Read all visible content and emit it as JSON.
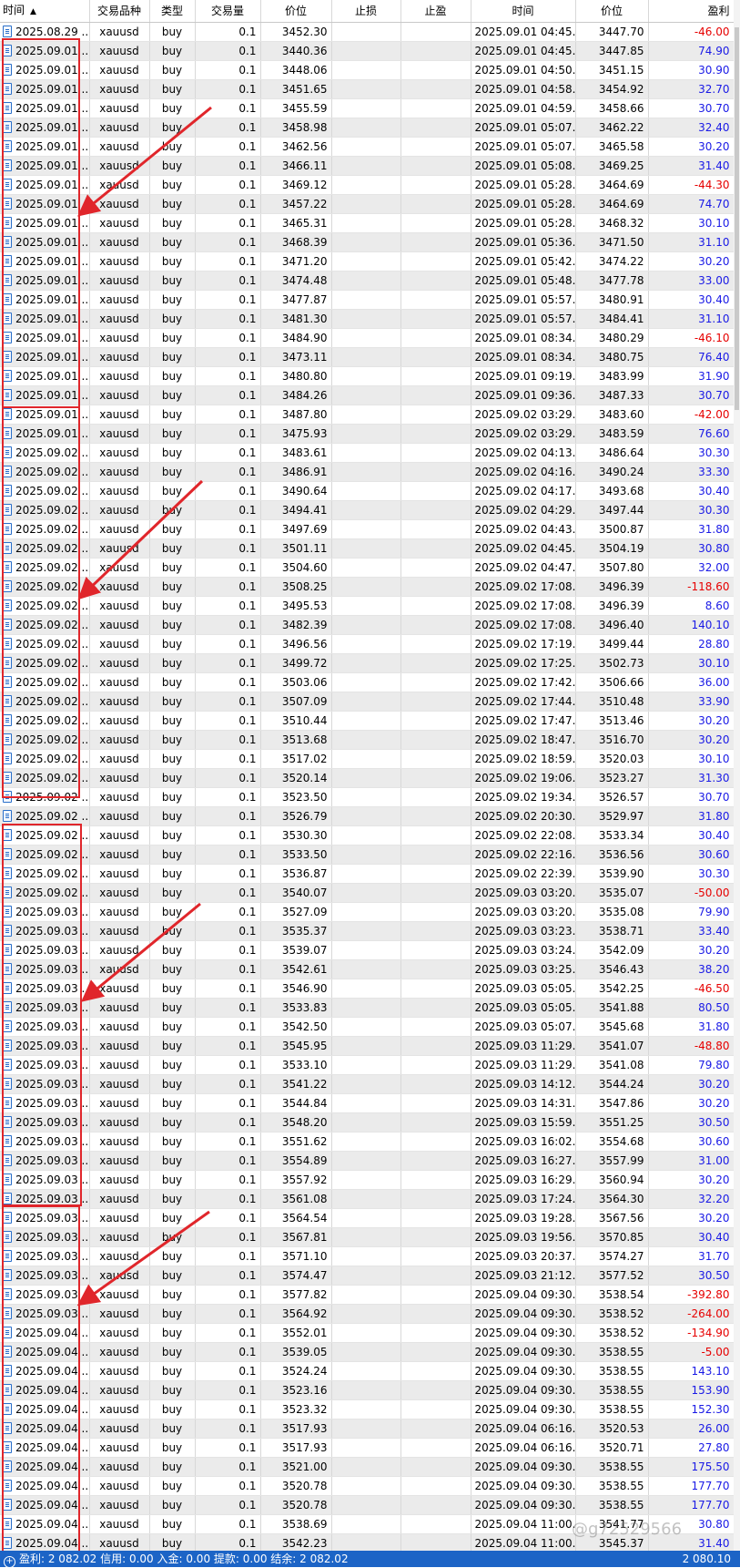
{
  "header": {
    "time": "时间",
    "symbol": "交易品种",
    "type": "类型",
    "volume": "交易量",
    "price": "价位",
    "sl": "止损",
    "tp": "止盈",
    "close_time": "时间",
    "close_price": "价位",
    "profit": "盈利"
  },
  "colors": {
    "status_bar": "#1c64c6",
    "profit_positive": "#1a1ae6",
    "profit_negative": "#e60000",
    "highlight": "#e0262b"
  },
  "rows": [
    {
      "t": "2025.08.29 ...",
      "s": "xauusd",
      "ty": "buy",
      "v": "0.1",
      "p": "3452.30",
      "ct": "2025.09.01 04:45...",
      "cp": "3447.70",
      "pr": "-46.00"
    },
    {
      "t": "2025.09.01 ...",
      "s": "xauusd",
      "ty": "buy",
      "v": "0.1",
      "p": "3440.36",
      "ct": "2025.09.01 04:45...",
      "cp": "3447.85",
      "pr": "74.90"
    },
    {
      "t": "2025.09.01 ...",
      "s": "xauusd",
      "ty": "buy",
      "v": "0.1",
      "p": "3448.06",
      "ct": "2025.09.01 04:50...",
      "cp": "3451.15",
      "pr": "30.90"
    },
    {
      "t": "2025.09.01 ...",
      "s": "xauusd",
      "ty": "buy",
      "v": "0.1",
      "p": "3451.65",
      "ct": "2025.09.01 04:58...",
      "cp": "3454.92",
      "pr": "32.70"
    },
    {
      "t": "2025.09.01 ...",
      "s": "xauusd",
      "ty": "buy",
      "v": "0.1",
      "p": "3455.59",
      "ct": "2025.09.01 04:59...",
      "cp": "3458.66",
      "pr": "30.70"
    },
    {
      "t": "2025.09.01 ...",
      "s": "xauusd",
      "ty": "buy",
      "v": "0.1",
      "p": "3458.98",
      "ct": "2025.09.01 05:07...",
      "cp": "3462.22",
      "pr": "32.40"
    },
    {
      "t": "2025.09.01 ...",
      "s": "xauusd",
      "ty": "buy",
      "v": "0.1",
      "p": "3462.56",
      "ct": "2025.09.01 05:07...",
      "cp": "3465.58",
      "pr": "30.20"
    },
    {
      "t": "2025.09.01 ...",
      "s": "xauusd",
      "ty": "buy",
      "v": "0.1",
      "p": "3466.11",
      "ct": "2025.09.01 05:08...",
      "cp": "3469.25",
      "pr": "31.40"
    },
    {
      "t": "2025.09.01 ...",
      "s": "xauusd",
      "ty": "buy",
      "v": "0.1",
      "p": "3469.12",
      "ct": "2025.09.01 05:28...",
      "cp": "3464.69",
      "pr": "-44.30"
    },
    {
      "t": "2025.09.01 ...",
      "s": "xauusd",
      "ty": "buy",
      "v": "0.1",
      "p": "3457.22",
      "ct": "2025.09.01 05:28...",
      "cp": "3464.69",
      "pr": "74.70"
    },
    {
      "t": "2025.09.01 ...",
      "s": "xauusd",
      "ty": "buy",
      "v": "0.1",
      "p": "3465.31",
      "ct": "2025.09.01 05:28...",
      "cp": "3468.32",
      "pr": "30.10"
    },
    {
      "t": "2025.09.01 ...",
      "s": "xauusd",
      "ty": "buy",
      "v": "0.1",
      "p": "3468.39",
      "ct": "2025.09.01 05:36...",
      "cp": "3471.50",
      "pr": "31.10"
    },
    {
      "t": "2025.09.01 ...",
      "s": "xauusd",
      "ty": "buy",
      "v": "0.1",
      "p": "3471.20",
      "ct": "2025.09.01 05:42...",
      "cp": "3474.22",
      "pr": "30.20"
    },
    {
      "t": "2025.09.01 ...",
      "s": "xauusd",
      "ty": "buy",
      "v": "0.1",
      "p": "3474.48",
      "ct": "2025.09.01 05:48...",
      "cp": "3477.78",
      "pr": "33.00"
    },
    {
      "t": "2025.09.01 ...",
      "s": "xauusd",
      "ty": "buy",
      "v": "0.1",
      "p": "3477.87",
      "ct": "2025.09.01 05:57...",
      "cp": "3480.91",
      "pr": "30.40"
    },
    {
      "t": "2025.09.01 ...",
      "s": "xauusd",
      "ty": "buy",
      "v": "0.1",
      "p": "3481.30",
      "ct": "2025.09.01 05:57...",
      "cp": "3484.41",
      "pr": "31.10"
    },
    {
      "t": "2025.09.01 ...",
      "s": "xauusd",
      "ty": "buy",
      "v": "0.1",
      "p": "3484.90",
      "ct": "2025.09.01 08:34...",
      "cp": "3480.29",
      "pr": "-46.10"
    },
    {
      "t": "2025.09.01 ...",
      "s": "xauusd",
      "ty": "buy",
      "v": "0.1",
      "p": "3473.11",
      "ct": "2025.09.01 08:34...",
      "cp": "3480.75",
      "pr": "76.40"
    },
    {
      "t": "2025.09.01 ...",
      "s": "xauusd",
      "ty": "buy",
      "v": "0.1",
      "p": "3480.80",
      "ct": "2025.09.01 09:19...",
      "cp": "3483.99",
      "pr": "31.90"
    },
    {
      "t": "2025.09.01 ...",
      "s": "xauusd",
      "ty": "buy",
      "v": "0.1",
      "p": "3484.26",
      "ct": "2025.09.01 09:36...",
      "cp": "3487.33",
      "pr": "30.70"
    },
    {
      "t": "2025.09.01 ...",
      "s": "xauusd",
      "ty": "buy",
      "v": "0.1",
      "p": "3487.80",
      "ct": "2025.09.02 03:29...",
      "cp": "3483.60",
      "pr": "-42.00"
    },
    {
      "t": "2025.09.01 ...",
      "s": "xauusd",
      "ty": "buy",
      "v": "0.1",
      "p": "3475.93",
      "ct": "2025.09.02 03:29...",
      "cp": "3483.59",
      "pr": "76.60"
    },
    {
      "t": "2025.09.02 ...",
      "s": "xauusd",
      "ty": "buy",
      "v": "0.1",
      "p": "3483.61",
      "ct": "2025.09.02 04:13...",
      "cp": "3486.64",
      "pr": "30.30"
    },
    {
      "t": "2025.09.02 ...",
      "s": "xauusd",
      "ty": "buy",
      "v": "0.1",
      "p": "3486.91",
      "ct": "2025.09.02 04:16...",
      "cp": "3490.24",
      "pr": "33.30"
    },
    {
      "t": "2025.09.02 ...",
      "s": "xauusd",
      "ty": "buy",
      "v": "0.1",
      "p": "3490.64",
      "ct": "2025.09.02 04:17...",
      "cp": "3493.68",
      "pr": "30.40"
    },
    {
      "t": "2025.09.02 ...",
      "s": "xauusd",
      "ty": "buy",
      "v": "0.1",
      "p": "3494.41",
      "ct": "2025.09.02 04:29...",
      "cp": "3497.44",
      "pr": "30.30"
    },
    {
      "t": "2025.09.02 ...",
      "s": "xauusd",
      "ty": "buy",
      "v": "0.1",
      "p": "3497.69",
      "ct": "2025.09.02 04:43...",
      "cp": "3500.87",
      "pr": "31.80"
    },
    {
      "t": "2025.09.02 ...",
      "s": "xauusd",
      "ty": "buy",
      "v": "0.1",
      "p": "3501.11",
      "ct": "2025.09.02 04:45...",
      "cp": "3504.19",
      "pr": "30.80"
    },
    {
      "t": "2025.09.02 ...",
      "s": "xauusd",
      "ty": "buy",
      "v": "0.1",
      "p": "3504.60",
      "ct": "2025.09.02 04:47...",
      "cp": "3507.80",
      "pr": "32.00"
    },
    {
      "t": "2025.09.02 ...",
      "s": "xauusd",
      "ty": "buy",
      "v": "0.1",
      "p": "3508.25",
      "ct": "2025.09.02 17:08...",
      "cp": "3496.39",
      "pr": "-118.60"
    },
    {
      "t": "2025.09.02 ...",
      "s": "xauusd",
      "ty": "buy",
      "v": "0.1",
      "p": "3495.53",
      "ct": "2025.09.02 17:08...",
      "cp": "3496.39",
      "pr": "8.60"
    },
    {
      "t": "2025.09.02 ...",
      "s": "xauusd",
      "ty": "buy",
      "v": "0.1",
      "p": "3482.39",
      "ct": "2025.09.02 17:08...",
      "cp": "3496.40",
      "pr": "140.10"
    },
    {
      "t": "2025.09.02 ...",
      "s": "xauusd",
      "ty": "buy",
      "v": "0.1",
      "p": "3496.56",
      "ct": "2025.09.02 17:19...",
      "cp": "3499.44",
      "pr": "28.80"
    },
    {
      "t": "2025.09.02 ...",
      "s": "xauusd",
      "ty": "buy",
      "v": "0.1",
      "p": "3499.72",
      "ct": "2025.09.02 17:25...",
      "cp": "3502.73",
      "pr": "30.10"
    },
    {
      "t": "2025.09.02 ...",
      "s": "xauusd",
      "ty": "buy",
      "v": "0.1",
      "p": "3503.06",
      "ct": "2025.09.02 17:42...",
      "cp": "3506.66",
      "pr": "36.00"
    },
    {
      "t": "2025.09.02 ...",
      "s": "xauusd",
      "ty": "buy",
      "v": "0.1",
      "p": "3507.09",
      "ct": "2025.09.02 17:44...",
      "cp": "3510.48",
      "pr": "33.90"
    },
    {
      "t": "2025.09.02 ...",
      "s": "xauusd",
      "ty": "buy",
      "v": "0.1",
      "p": "3510.44",
      "ct": "2025.09.02 17:47...",
      "cp": "3513.46",
      "pr": "30.20"
    },
    {
      "t": "2025.09.02 ...",
      "s": "xauusd",
      "ty": "buy",
      "v": "0.1",
      "p": "3513.68",
      "ct": "2025.09.02 18:47...",
      "cp": "3516.70",
      "pr": "30.20"
    },
    {
      "t": "2025.09.02 ...",
      "s": "xauusd",
      "ty": "buy",
      "v": "0.1",
      "p": "3517.02",
      "ct": "2025.09.02 18:59...",
      "cp": "3520.03",
      "pr": "30.10"
    },
    {
      "t": "2025.09.02 ...",
      "s": "xauusd",
      "ty": "buy",
      "v": "0.1",
      "p": "3520.14",
      "ct": "2025.09.02 19:06...",
      "cp": "3523.27",
      "pr": "31.30"
    },
    {
      "t": "2025.09.02 ...",
      "s": "xauusd",
      "ty": "buy",
      "v": "0.1",
      "p": "3523.50",
      "ct": "2025.09.02 19:34...",
      "cp": "3526.57",
      "pr": "30.70"
    },
    {
      "t": "2025.09.02 ...",
      "s": "xauusd",
      "ty": "buy",
      "v": "0.1",
      "p": "3526.79",
      "ct": "2025.09.02 20:30...",
      "cp": "3529.97",
      "pr": "31.80"
    },
    {
      "t": "2025.09.02 ...",
      "s": "xauusd",
      "ty": "buy",
      "v": "0.1",
      "p": "3530.30",
      "ct": "2025.09.02 22:08...",
      "cp": "3533.34",
      "pr": "30.40"
    },
    {
      "t": "2025.09.02 ...",
      "s": "xauusd",
      "ty": "buy",
      "v": "0.1",
      "p": "3533.50",
      "ct": "2025.09.02 22:16...",
      "cp": "3536.56",
      "pr": "30.60"
    },
    {
      "t": "2025.09.02 ...",
      "s": "xauusd",
      "ty": "buy",
      "v": "0.1",
      "p": "3536.87",
      "ct": "2025.09.02 22:39...",
      "cp": "3539.90",
      "pr": "30.30"
    },
    {
      "t": "2025.09.02 ...",
      "s": "xauusd",
      "ty": "buy",
      "v": "0.1",
      "p": "3540.07",
      "ct": "2025.09.03 03:20...",
      "cp": "3535.07",
      "pr": "-50.00"
    },
    {
      "t": "2025.09.03 ...",
      "s": "xauusd",
      "ty": "buy",
      "v": "0.1",
      "p": "3527.09",
      "ct": "2025.09.03 03:20...",
      "cp": "3535.08",
      "pr": "79.90"
    },
    {
      "t": "2025.09.03 ...",
      "s": "xauusd",
      "ty": "buy",
      "v": "0.1",
      "p": "3535.37",
      "ct": "2025.09.03 03:23...",
      "cp": "3538.71",
      "pr": "33.40"
    },
    {
      "t": "2025.09.03 ...",
      "s": "xauusd",
      "ty": "buy",
      "v": "0.1",
      "p": "3539.07",
      "ct": "2025.09.03 03:24...",
      "cp": "3542.09",
      "pr": "30.20"
    },
    {
      "t": "2025.09.03 ...",
      "s": "xauusd",
      "ty": "buy",
      "v": "0.1",
      "p": "3542.61",
      "ct": "2025.09.03 03:25...",
      "cp": "3546.43",
      "pr": "38.20"
    },
    {
      "t": "2025.09.03 ...",
      "s": "xauusd",
      "ty": "buy",
      "v": "0.1",
      "p": "3546.90",
      "ct": "2025.09.03 05:05...",
      "cp": "3542.25",
      "pr": "-46.50"
    },
    {
      "t": "2025.09.03 ...",
      "s": "xauusd",
      "ty": "buy",
      "v": "0.1",
      "p": "3533.83",
      "ct": "2025.09.03 05:05...",
      "cp": "3541.88",
      "pr": "80.50"
    },
    {
      "t": "2025.09.03 ...",
      "s": "xauusd",
      "ty": "buy",
      "v": "0.1",
      "p": "3542.50",
      "ct": "2025.09.03 05:07...",
      "cp": "3545.68",
      "pr": "31.80"
    },
    {
      "t": "2025.09.03 ...",
      "s": "xauusd",
      "ty": "buy",
      "v": "0.1",
      "p": "3545.95",
      "ct": "2025.09.03 11:29...",
      "cp": "3541.07",
      "pr": "-48.80"
    },
    {
      "t": "2025.09.03 ...",
      "s": "xauusd",
      "ty": "buy",
      "v": "0.1",
      "p": "3533.10",
      "ct": "2025.09.03 11:29...",
      "cp": "3541.08",
      "pr": "79.80"
    },
    {
      "t": "2025.09.03 ...",
      "s": "xauusd",
      "ty": "buy",
      "v": "0.1",
      "p": "3541.22",
      "ct": "2025.09.03 14:12...",
      "cp": "3544.24",
      "pr": "30.20"
    },
    {
      "t": "2025.09.03 ...",
      "s": "xauusd",
      "ty": "buy",
      "v": "0.1",
      "p": "3544.84",
      "ct": "2025.09.03 14:31...",
      "cp": "3547.86",
      "pr": "30.20"
    },
    {
      "t": "2025.09.03 ...",
      "s": "xauusd",
      "ty": "buy",
      "v": "0.1",
      "p": "3548.20",
      "ct": "2025.09.03 15:59...",
      "cp": "3551.25",
      "pr": "30.50"
    },
    {
      "t": "2025.09.03 ...",
      "s": "xauusd",
      "ty": "buy",
      "v": "0.1",
      "p": "3551.62",
      "ct": "2025.09.03 16:02...",
      "cp": "3554.68",
      "pr": "30.60"
    },
    {
      "t": "2025.09.03 ...",
      "s": "xauusd",
      "ty": "buy",
      "v": "0.1",
      "p": "3554.89",
      "ct": "2025.09.03 16:27...",
      "cp": "3557.99",
      "pr": "31.00"
    },
    {
      "t": "2025.09.03 ...",
      "s": "xauusd",
      "ty": "buy",
      "v": "0.1",
      "p": "3557.92",
      "ct": "2025.09.03 16:29...",
      "cp": "3560.94",
      "pr": "30.20"
    },
    {
      "t": "2025.09.03 ...",
      "s": "xauusd",
      "ty": "buy",
      "v": "0.1",
      "p": "3561.08",
      "ct": "2025.09.03 17:24...",
      "cp": "3564.30",
      "pr": "32.20"
    },
    {
      "t": "2025.09.03 ...",
      "s": "xauusd",
      "ty": "buy",
      "v": "0.1",
      "p": "3564.54",
      "ct": "2025.09.03 19:28...",
      "cp": "3567.56",
      "pr": "30.20"
    },
    {
      "t": "2025.09.03 ...",
      "s": "xauusd",
      "ty": "buy",
      "v": "0.1",
      "p": "3567.81",
      "ct": "2025.09.03 19:56...",
      "cp": "3570.85",
      "pr": "30.40"
    },
    {
      "t": "2025.09.03 ...",
      "s": "xauusd",
      "ty": "buy",
      "v": "0.1",
      "p": "3571.10",
      "ct": "2025.09.03 20:37...",
      "cp": "3574.27",
      "pr": "31.70"
    },
    {
      "t": "2025.09.03 ...",
      "s": "xauusd",
      "ty": "buy",
      "v": "0.1",
      "p": "3574.47",
      "ct": "2025.09.03 21:12...",
      "cp": "3577.52",
      "pr": "30.50"
    },
    {
      "t": "2025.09.03 ...",
      "s": "xauusd",
      "ty": "buy",
      "v": "0.1",
      "p": "3577.82",
      "ct": "2025.09.04 09:30...",
      "cp": "3538.54",
      "pr": "-392.80"
    },
    {
      "t": "2025.09.03 ...",
      "s": "xauusd",
      "ty": "buy",
      "v": "0.1",
      "p": "3564.92",
      "ct": "2025.09.04 09:30...",
      "cp": "3538.52",
      "pr": "-264.00"
    },
    {
      "t": "2025.09.04 ...",
      "s": "xauusd",
      "ty": "buy",
      "v": "0.1",
      "p": "3552.01",
      "ct": "2025.09.04 09:30...",
      "cp": "3538.52",
      "pr": "-134.90"
    },
    {
      "t": "2025.09.04 ...",
      "s": "xauusd",
      "ty": "buy",
      "v": "0.1",
      "p": "3539.05",
      "ct": "2025.09.04 09:30...",
      "cp": "3538.55",
      "pr": "-5.00"
    },
    {
      "t": "2025.09.04 ...",
      "s": "xauusd",
      "ty": "buy",
      "v": "0.1",
      "p": "3524.24",
      "ct": "2025.09.04 09:30...",
      "cp": "3538.55",
      "pr": "143.10"
    },
    {
      "t": "2025.09.04 ...",
      "s": "xauusd",
      "ty": "buy",
      "v": "0.1",
      "p": "3523.16",
      "ct": "2025.09.04 09:30...",
      "cp": "3538.55",
      "pr": "153.90"
    },
    {
      "t": "2025.09.04 ...",
      "s": "xauusd",
      "ty": "buy",
      "v": "0.1",
      "p": "3523.32",
      "ct": "2025.09.04 09:30...",
      "cp": "3538.55",
      "pr": "152.30"
    },
    {
      "t": "2025.09.04 ...",
      "s": "xauusd",
      "ty": "buy",
      "v": "0.1",
      "p": "3517.93",
      "ct": "2025.09.04 06:16...",
      "cp": "3520.53",
      "pr": "26.00"
    },
    {
      "t": "2025.09.04 ...",
      "s": "xauusd",
      "ty": "buy",
      "v": "0.1",
      "p": "3517.93",
      "ct": "2025.09.04 06:16...",
      "cp": "3520.71",
      "pr": "27.80"
    },
    {
      "t": "2025.09.04 ...",
      "s": "xauusd",
      "ty": "buy",
      "v": "0.1",
      "p": "3521.00",
      "ct": "2025.09.04 09:30...",
      "cp": "3538.55",
      "pr": "175.50"
    },
    {
      "t": "2025.09.04 ...",
      "s": "xauusd",
      "ty": "buy",
      "v": "0.1",
      "p": "3520.78",
      "ct": "2025.09.04 09:30...",
      "cp": "3538.55",
      "pr": "177.70"
    },
    {
      "t": "2025.09.04 ...",
      "s": "xauusd",
      "ty": "buy",
      "v": "0.1",
      "p": "3520.78",
      "ct": "2025.09.04 09:30...",
      "cp": "3538.55",
      "pr": "177.70"
    },
    {
      "t": "2025.09.04 ...",
      "s": "xauusd",
      "ty": "buy",
      "v": "0.1",
      "p": "3538.69",
      "ct": "2025.09.04 11:00...",
      "cp": "3541.77",
      "pr": "30.80"
    },
    {
      "t": "2025.09.04 ...",
      "s": "xauusd",
      "ty": "buy",
      "v": "0.1",
      "p": "3542.23",
      "ct": "2025.09.04 11:00...",
      "cp": "3545.37",
      "pr": "31.40"
    }
  ],
  "status": {
    "summary": "盈利: 2 082.02  信用: 0.00  入金: 0.00  提款: 0.00  结余: 2 082.02",
    "total": "2 080.10"
  },
  "watermark": "@g72529566"
}
